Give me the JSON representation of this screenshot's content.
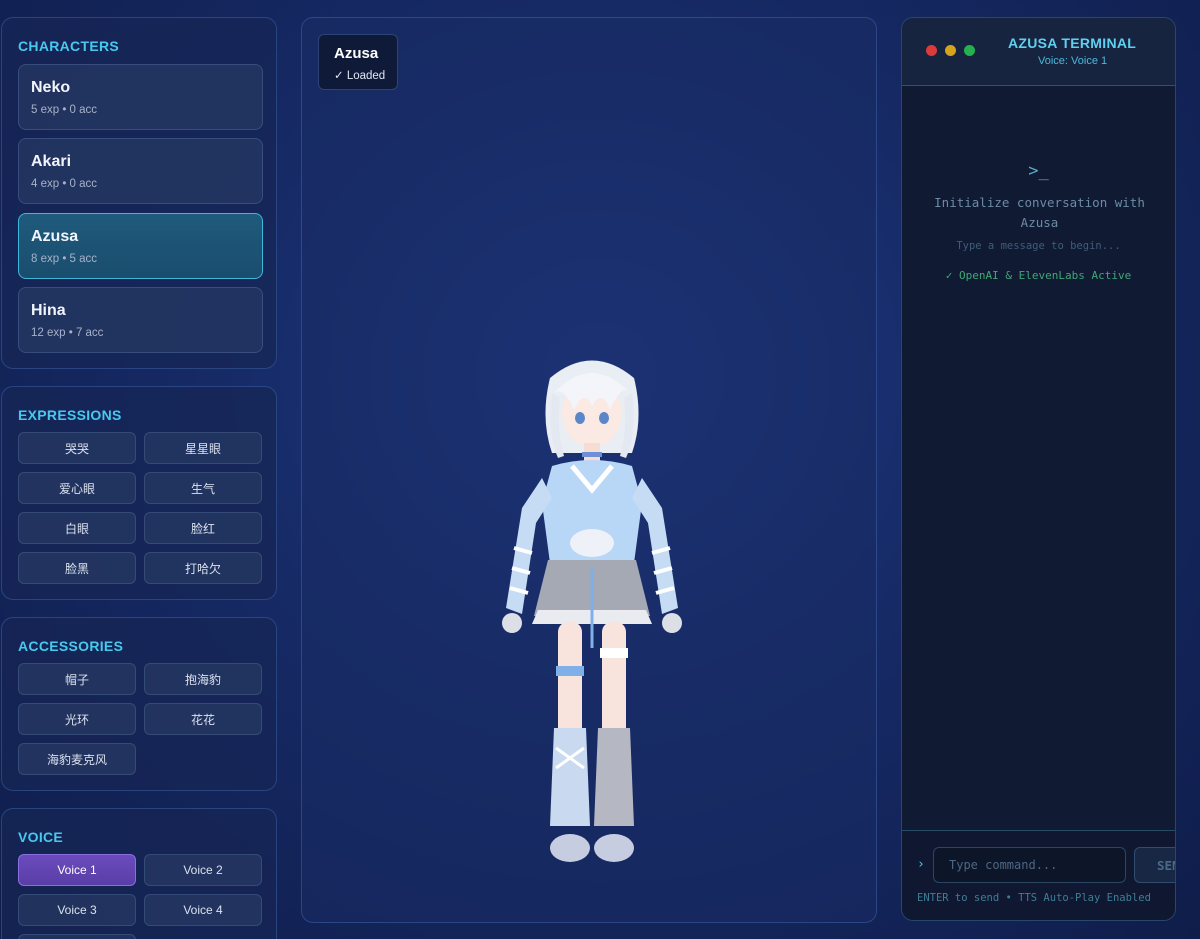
{
  "characters": {
    "title": "CHARACTERS",
    "items": [
      {
        "name": "Neko",
        "meta": "5 exp • 0 acc"
      },
      {
        "name": "Akari",
        "meta": "4 exp • 0 acc"
      },
      {
        "name": "Azusa",
        "meta": "8 exp • 5 acc"
      },
      {
        "name": "Hina",
        "meta": "12 exp • 7 acc"
      }
    ]
  },
  "expressions": {
    "title": "EXPRESSIONS",
    "items": [
      "哭哭",
      "星星眼",
      "爱心眼",
      "生气",
      "白眼",
      "脸红",
      "脸黑",
      "打哈欠"
    ]
  },
  "accessories": {
    "title": "ACCESSORIES",
    "items": [
      "帽子",
      "抱海豹",
      "光环",
      "花花",
      "海豹麦克风"
    ]
  },
  "voice": {
    "title": "VOICE",
    "items": [
      "Voice 1",
      "Voice 2",
      "Voice 3",
      "Voice 4"
    ]
  },
  "viewer": {
    "character": "Azusa",
    "status": "✓ Loaded"
  },
  "terminal": {
    "title": "AZUSA TERMINAL",
    "subtitle": "Voice: Voice 1",
    "prompt_symbol": ">_",
    "init_line": "Initialize conversation with Azusa",
    "hint": "Type a message to begin...",
    "active": "✓ OpenAI & ElevenLabs Active",
    "input_placeholder": "Type command...",
    "send_label": "SEND",
    "footer": "ENTER to send • TTS Auto-Play Enabled",
    "caret": "›"
  }
}
